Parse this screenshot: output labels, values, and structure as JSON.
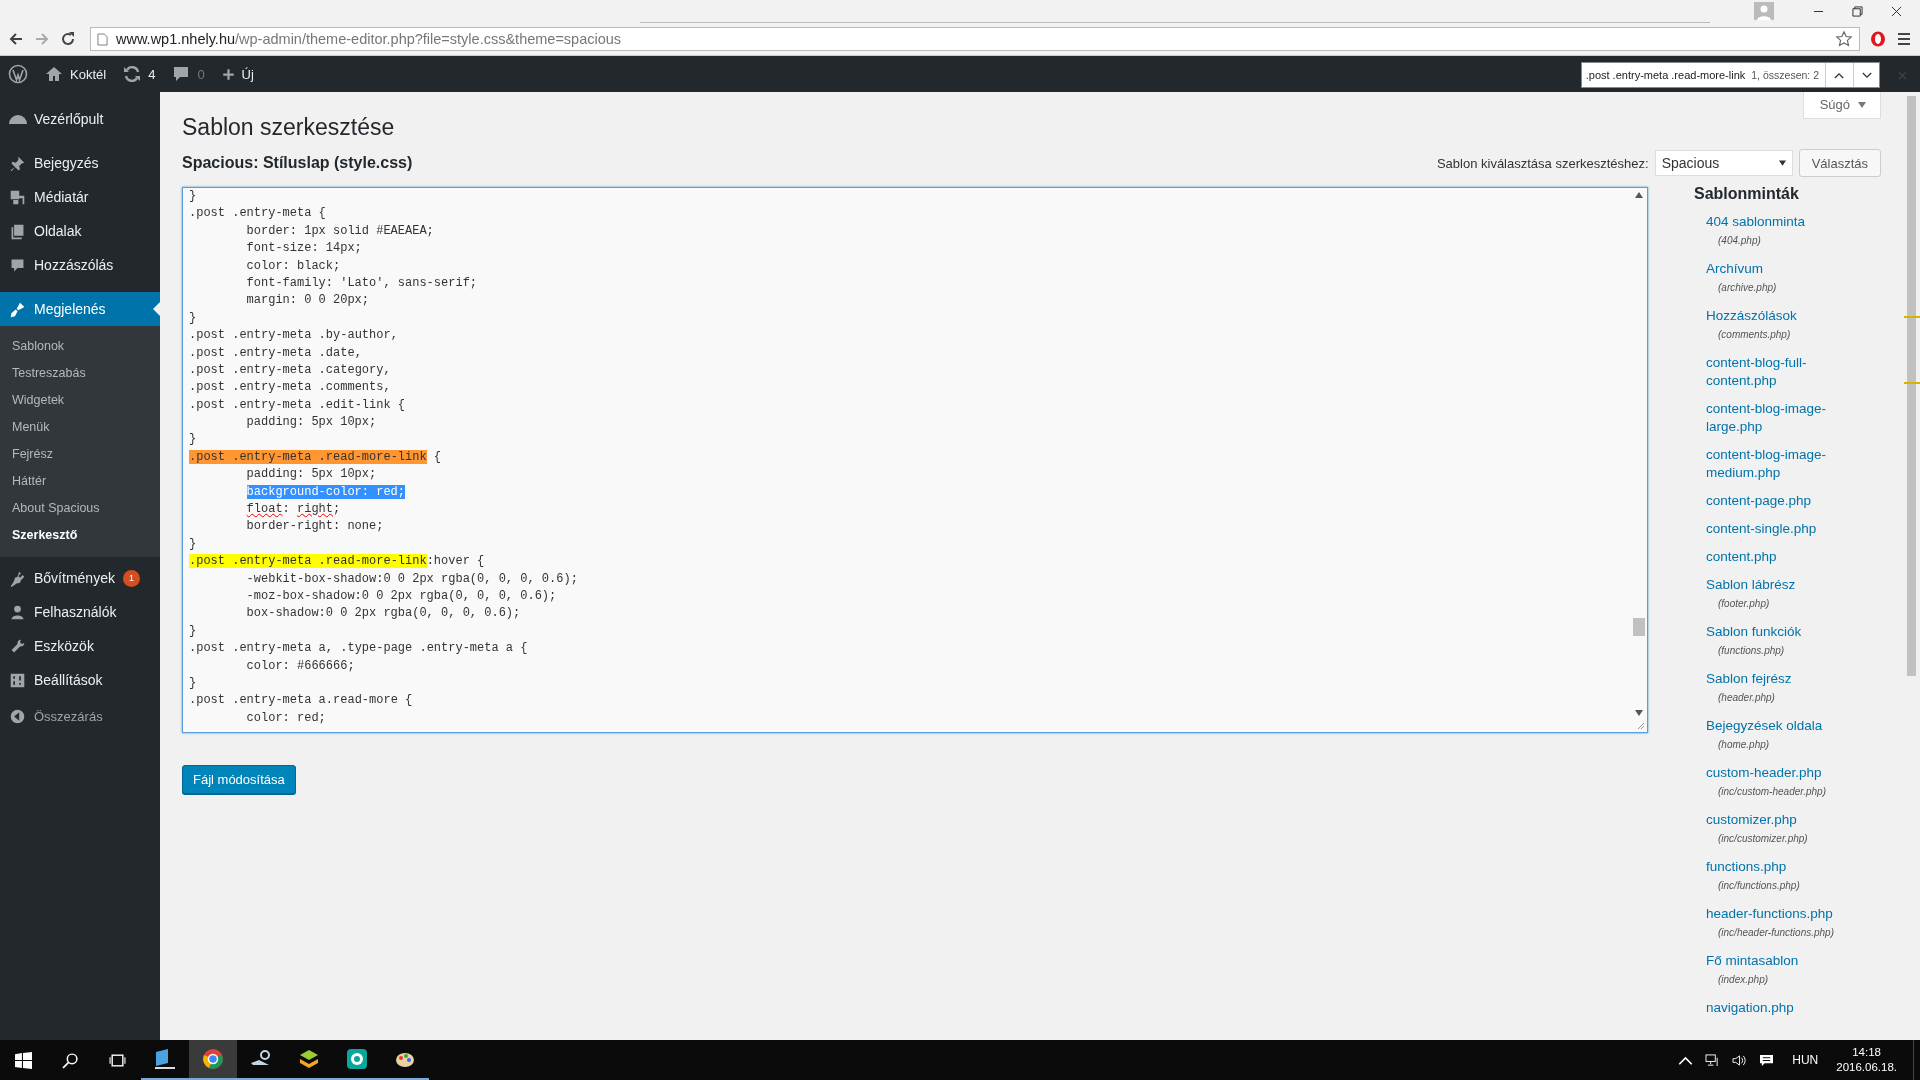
{
  "browser": {
    "url_host": "www.wp1.nhely.hu",
    "url_path": "/wp-admin/theme-editor.php?file=style.css&theme=spacious"
  },
  "admin_bar": {
    "site": "Koktél",
    "updates": "4",
    "comments": "0",
    "new": "Új"
  },
  "find_bar": {
    "query": ".post .entry-meta .read-more-link",
    "count": "1, összesen: 2"
  },
  "sidebar": {
    "items": [
      {
        "label": "Vezérlőpult",
        "selected": false
      },
      {
        "label": "Bejegyzés",
        "selected": false
      },
      {
        "label": "Médiatár",
        "selected": false
      },
      {
        "label": "Oldalak",
        "selected": false
      },
      {
        "label": "Hozzászólás",
        "selected": false
      },
      {
        "label": "Megjelenés",
        "selected": true,
        "children": [
          {
            "label": "Sablonok",
            "selected": false
          },
          {
            "label": "Testreszabás",
            "selected": false
          },
          {
            "label": "Widgetek",
            "selected": false
          },
          {
            "label": "Menük",
            "selected": false
          },
          {
            "label": "Fejrész",
            "selected": false
          },
          {
            "label": "Háttér",
            "selected": false
          },
          {
            "label": "About Spacious",
            "selected": false
          },
          {
            "label": "Szerkesztő",
            "selected": true
          }
        ]
      },
      {
        "label": "Bővítmények",
        "selected": false,
        "badge": "1"
      },
      {
        "label": "Felhasználók",
        "selected": false
      },
      {
        "label": "Eszközök",
        "selected": false
      },
      {
        "label": "Beállítások",
        "selected": false
      }
    ],
    "collapse": "Összezárás"
  },
  "page": {
    "title": "Sablon szerkesztése",
    "help_tab": "Súgó",
    "file_heading": "Spacious: Stíluslap (style.css)",
    "select_label": "Sablon kiválasztása szerkesztéshez:",
    "select_value": "Spacious",
    "select_button": "Választás",
    "submit_button": "Fájl módosítása"
  },
  "editor": {
    "lines": [
      {
        "indent": false,
        "parts": [
          {
            "text": "}",
            "kind": "plain"
          }
        ]
      },
      {
        "indent": false,
        "parts": [
          {
            "text": ".post .entry-meta {",
            "kind": "plain"
          }
        ]
      },
      {
        "indent": true,
        "parts": [
          {
            "text": "border: 1px solid #EAEAEA;",
            "kind": "plain"
          }
        ]
      },
      {
        "indent": true,
        "parts": [
          {
            "text": "font-size: 14px;",
            "kind": "plain"
          }
        ]
      },
      {
        "indent": true,
        "parts": [
          {
            "text": "color: black;",
            "kind": "plain"
          }
        ]
      },
      {
        "indent": true,
        "parts": [
          {
            "text": "font-family: 'Lato', sans-serif;",
            "kind": "plain"
          }
        ]
      },
      {
        "indent": true,
        "parts": [
          {
            "text": "margin: 0 0 20px;",
            "kind": "plain"
          }
        ]
      },
      {
        "indent": false,
        "parts": [
          {
            "text": "}",
            "kind": "plain"
          }
        ]
      },
      {
        "indent": false,
        "parts": [
          {
            "text": ".post .entry-meta .by-author,",
            "kind": "plain"
          }
        ]
      },
      {
        "indent": false,
        "parts": [
          {
            "text": ".post .entry-meta .date,",
            "kind": "plain"
          }
        ]
      },
      {
        "indent": false,
        "parts": [
          {
            "text": ".post .entry-meta .category,",
            "kind": "plain"
          }
        ]
      },
      {
        "indent": false,
        "parts": [
          {
            "text": ".post .entry-meta .comments,",
            "kind": "plain"
          }
        ]
      },
      {
        "indent": false,
        "parts": [
          {
            "text": ".post .entry-meta .edit-link {",
            "kind": "plain"
          }
        ]
      },
      {
        "indent": true,
        "parts": [
          {
            "text": "padding: 5px 10px;",
            "kind": "plain"
          }
        ]
      },
      {
        "indent": false,
        "parts": [
          {
            "text": "}",
            "kind": "plain"
          }
        ]
      },
      {
        "indent": false,
        "parts": [
          {
            "text": ".post .entry-meta .read-more-link",
            "kind": "current"
          },
          {
            "text": " {",
            "kind": "plain"
          }
        ]
      },
      {
        "indent": true,
        "parts": [
          {
            "text": "padding: 5px 10px;",
            "kind": "plain"
          }
        ]
      },
      {
        "indent": true,
        "parts": [
          {
            "text": "background-color: red;",
            "kind": "selection"
          }
        ]
      },
      {
        "indent": true,
        "parts": [
          {
            "text": "float",
            "kind": "misspelled"
          },
          {
            "text": ": ",
            "kind": "plain"
          },
          {
            "text": "right",
            "kind": "misspelled"
          },
          {
            "text": ";",
            "kind": "plain"
          }
        ]
      },
      {
        "indent": true,
        "parts": [
          {
            "text": "border-right: none;",
            "kind": "plain"
          }
        ]
      },
      {
        "indent": false,
        "parts": [
          {
            "text": "}",
            "kind": "plain"
          }
        ]
      },
      {
        "indent": false,
        "parts": [
          {
            "text": ".post .entry-meta .read-more-link",
            "kind": "match"
          },
          {
            "text": ":hover {",
            "kind": "plain"
          }
        ]
      },
      {
        "indent": true,
        "parts": [
          {
            "text": "-webkit-box-shadow:0 0 2px rgba(0, 0, 0, 0.6);",
            "kind": "plain"
          }
        ]
      },
      {
        "indent": true,
        "parts": [
          {
            "text": "-moz-box-shadow:0 0 2px rgba(0, 0, 0, 0.6);",
            "kind": "plain"
          }
        ]
      },
      {
        "indent": true,
        "parts": [
          {
            "text": "box-shadow:0 0 2px rgba(0, 0, 0, 0.6);",
            "kind": "plain"
          }
        ]
      },
      {
        "indent": false,
        "parts": [
          {
            "text": "}",
            "kind": "plain"
          }
        ]
      },
      {
        "indent": false,
        "parts": [
          {
            "text": ".post .entry-meta a, .type-page .entry-meta a {",
            "kind": "plain"
          }
        ]
      },
      {
        "indent": true,
        "parts": [
          {
            "text": "color: #666666;",
            "kind": "plain"
          }
        ]
      },
      {
        "indent": false,
        "parts": [
          {
            "text": "}",
            "kind": "plain"
          }
        ]
      },
      {
        "indent": false,
        "parts": [
          {
            "text": ".post .entry-meta a.read-more {",
            "kind": "plain"
          }
        ]
      },
      {
        "indent": true,
        "parts": [
          {
            "text": "color: red;",
            "kind": "plain"
          }
        ]
      }
    ]
  },
  "templates": {
    "heading": "Sablonminták",
    "files": [
      {
        "name": "404 sablonminta",
        "file": "(404.php)"
      },
      {
        "name": "Archívum",
        "file": "(archive.php)"
      },
      {
        "name": "Hozzászólások",
        "file": "(comments.php)"
      },
      {
        "name": "content-blog-full-content.php"
      },
      {
        "name": "content-blog-image-large.php"
      },
      {
        "name": "content-blog-image-medium.php"
      },
      {
        "name": "content-page.php"
      },
      {
        "name": "content-single.php"
      },
      {
        "name": "content.php"
      },
      {
        "name": "Sablon lábrész",
        "file": "(footer.php)"
      },
      {
        "name": "Sablon funkciók",
        "file": "(functions.php)"
      },
      {
        "name": "Sablon fejrész",
        "file": "(header.php)"
      },
      {
        "name": "Bejegyzések oldala",
        "file": "(home.php)"
      },
      {
        "name": "custom-header.php",
        "file": "(inc/custom-header.php)"
      },
      {
        "name": "customizer.php",
        "file": "(inc/customizer.php)"
      },
      {
        "name": "functions.php",
        "file": "(inc/functions.php)"
      },
      {
        "name": "header-functions.php",
        "file": "(inc/header-functions.php)"
      },
      {
        "name": "Fő mintasablon",
        "file": "(index.php)"
      },
      {
        "name": "navigation.php"
      }
    ]
  },
  "taskbar": {
    "apps": [
      {
        "active": false
      },
      {
        "active": true
      },
      {
        "active": false
      },
      {
        "active": false
      },
      {
        "active": false
      },
      {
        "active": false
      }
    ],
    "language": "HUN",
    "time": "14:18",
    "date": "2016.06.18."
  }
}
